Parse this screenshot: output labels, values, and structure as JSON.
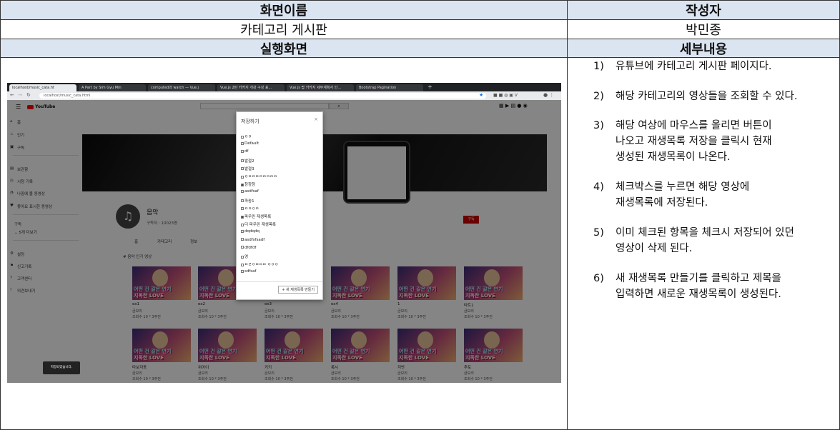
{
  "table": {
    "screen_name_header": "화면이름",
    "author_header": "작성자",
    "screen_name": "카테고리 게시판",
    "author": "박민종",
    "run_screen_header": "실행화면",
    "details_header": "세부내용"
  },
  "details": [
    {
      "num": "1)",
      "lines": [
        "유튜브에 카테고리 게시판 페이지다."
      ]
    },
    {
      "num": "2)",
      "lines": [
        "해당 카테고리의 영상들을 조회할 수 있다."
      ]
    },
    {
      "num": "3)",
      "lines": [
        "해당 여상에 마우스를 올리면 버튼이",
        "나오고 재생목록 저장을 클릭시 현재",
        "생성된 재생목록이 나온다."
      ]
    },
    {
      "num": "4)",
      "lines": [
        "체크박스를 누르면 해당 영상에",
        "재생목록에 저장된다."
      ]
    },
    {
      "num": "5)",
      "lines": [
        "이미 체크된 항목을 체크시 저장되어 있던",
        "영상이 삭제 된다."
      ]
    },
    {
      "num": "6)",
      "lines": [
        "새 재생목록 만들기를 클릭하고 제목을",
        "입력하면 새로운 재생목록이 생성된다."
      ]
    }
  ],
  "browser": {
    "tabs": [
      "localhost/music_cata.ht",
      "A Part by Sim Gyu Min",
      "computed과 watch — Vue.j",
      "Vue.js 2탄 카카지 개강 구성 표...",
      "Vue.js 팝 카카지 세부계획서 인...",
      "Bootstrap Pagination"
    ],
    "url": "localhost/music_cata.html",
    "youtube_logo": "YouTube",
    "sidebar": [
      "홈",
      "인기",
      "구독",
      "보관함",
      "시청 기록",
      "나중에 볼 동영상",
      "좋아요 표시한 동영상",
      "구독",
      "5개 더보기",
      "설정",
      "신고기록",
      "고객센터",
      "의견보내기"
    ],
    "channel_name": "음악",
    "subscribers": "구독자 : 10023명",
    "channel_tabs": [
      "홈",
      "카테고리",
      "정보"
    ],
    "section_title": "# 음악 인기 영상",
    "subscribe_btn": "구독",
    "thumb_line1": "어떤 건 갈은 연기",
    "thumb_line2": "지독한 LOVE",
    "videos_row1": [
      {
        "title": "ex1",
        "channel": "금보리",
        "meta": "조회수 10 * 3주전"
      },
      {
        "title": "ex2",
        "channel": "금보리",
        "meta": "조회수 10 * 3주전"
      },
      {
        "title": "ex3",
        "channel": "금보리",
        "meta": "조회수 10 * 3주전"
      },
      {
        "title": "ex4",
        "channel": "금보리",
        "meta": "조회수 10 * 3주전"
      },
      {
        "title": "1",
        "channel": "금보리",
        "meta": "조회수 10 * 3주전"
      },
      {
        "title": "타트1",
        "channel": "금보리",
        "meta": "조회수 10 * 3주전"
      }
    ],
    "videos_row2": [
      {
        "title": "타보지동",
        "channel": "금보리",
        "meta": "조회수 10 * 3주전"
      },
      {
        "title": "위아이",
        "channel": "금보리",
        "meta": "조회수 10 * 3주전"
      },
      {
        "title": "키키",
        "channel": "금보리",
        "meta": "조회수 10 * 3주전"
      },
      {
        "title": "룩시",
        "channel": "금보리",
        "meta": "조회수 10 * 3주전"
      },
      {
        "title": "지반",
        "channel": "금보리",
        "meta": "조회수 10 * 3주전"
      },
      {
        "title": "추토",
        "channel": "금보리",
        "meta": "조회수 10 * 3주전"
      }
    ],
    "dialog": {
      "title": "저장하기",
      "close": "×",
      "playlists": [
        {
          "label": "ㅇㅇ",
          "checked": false
        },
        {
          "label": "Default",
          "checked": false
        },
        {
          "label": "df",
          "checked": false
        },
        {
          "label": "발절2",
          "checked": false
        },
        {
          "label": "발절3",
          "checked": false
        },
        {
          "label": "ㅇㅁㅁㅁㅁㅁㅁㅁㅁ",
          "checked": false
        },
        {
          "label": "창창창",
          "checked": true
        },
        {
          "label": "asdfsaf",
          "checked": false
        },
        {
          "label": "파송1",
          "checked": false
        },
        {
          "label": "ㅁㅁㅇㅁ",
          "checked": false
        },
        {
          "label": "파우린 재생목록",
          "checked": true
        },
        {
          "label": "더 파우린 재생목록",
          "checked": false
        },
        {
          "label": "dqdqdq",
          "checked": false
        },
        {
          "label": "asdfsfsadf",
          "checked": false
        },
        {
          "label": "dfdfdf",
          "checked": false
        },
        {
          "label": "영",
          "checked": false
        },
        {
          "label": "ㅁㄹㅇㅁㅁㅁ ㅇㅇㅇ",
          "checked": false
        },
        {
          "label": "sdfsaf",
          "checked": false
        }
      ],
      "new_playlist_btn": "+ 새 재생목록 만들기"
    },
    "toast": "저장되었습니다."
  }
}
